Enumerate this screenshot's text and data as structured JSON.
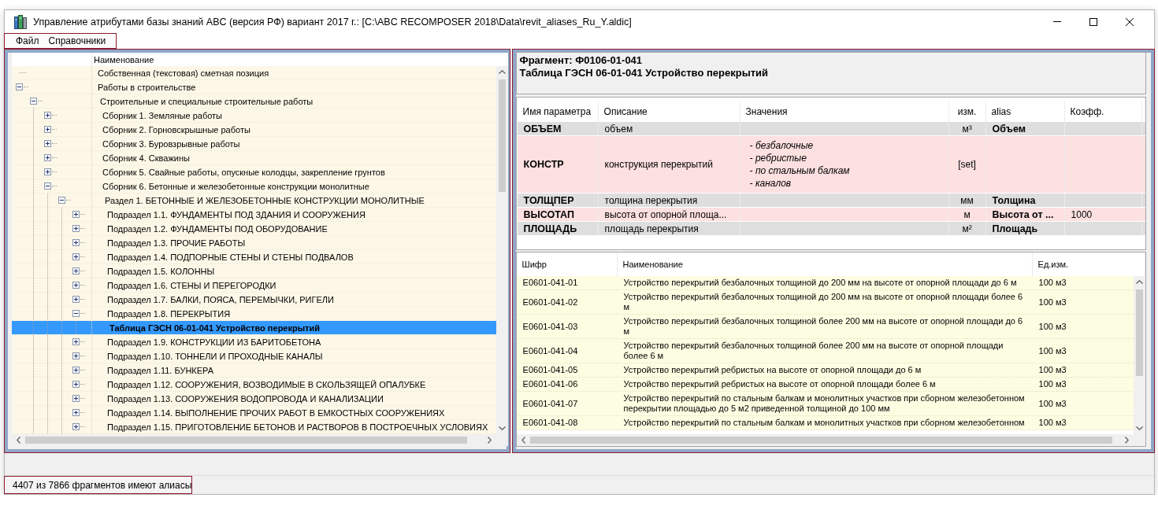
{
  "window": {
    "title": "Управление атрибутами базы знаний ABC (версия РФ) вариант 2017 г.: [C:\\ABC RECOMPOSER 2018\\Data\\revit_aliases_Ru_Y.aldic]"
  },
  "menu": [
    "Файл",
    "Справочники"
  ],
  "tree": {
    "column": "Наименование",
    "items": [
      {
        "label": "Собственная (текстовая) сметная позиция",
        "selected": false
      },
      {
        "label": "Работы в строительстве",
        "expanded": true,
        "selected": false,
        "children": [
          {
            "label": "Строительные и специальные строительные работы",
            "expanded": true,
            "selected": false,
            "children": [
              {
                "label": "Сборник 1. Земляные работы",
                "expanded": false,
                "selected": false
              },
              {
                "label": "Сборник 2. Горновскрышные работы",
                "expanded": false,
                "selected": false
              },
              {
                "label": "Сборник 3. Буровзрывные работы",
                "expanded": false,
                "selected": false
              },
              {
                "label": "Сборник 4. Скважины",
                "expanded": false,
                "selected": false
              },
              {
                "label": "Сборник 5. Свайные работы, опускные колодцы, закрепление грунтов",
                "expanded": false,
                "selected": false
              },
              {
                "label": "Сборник 6. Бетонные и железобетонные конструкции монолитные",
                "expanded": true,
                "selected": false,
                "children": [
                  {
                    "label": "Раздел 1. БЕТОННЫЕ И ЖЕЛЕЗОБЕТОННЫЕ КОНСТРУКЦИИ МОНОЛИТНЫЕ",
                    "expanded": true,
                    "selected": false,
                    "children": [
                      {
                        "label": "Подраздел 1.1. ФУНДАМЕНТЫ ПОД ЗДАНИЯ И СООРУЖЕНИЯ",
                        "expanded": false,
                        "selected": false
                      },
                      {
                        "label": "Подраздел 1.2. ФУНДАМЕНТЫ ПОД ОБОРУДОВАНИЕ",
                        "expanded": false,
                        "selected": false
                      },
                      {
                        "label": "Подраздел 1.3. ПРОЧИЕ РАБОТЫ",
                        "expanded": false,
                        "selected": false
                      },
                      {
                        "label": "Подраздел 1.4. ПОДПОРНЫЕ СТЕНЫ И СТЕНЫ ПОДВАЛОВ",
                        "expanded": false,
                        "selected": false
                      },
                      {
                        "label": "Подраздел 1.5. КОЛОННЫ",
                        "expanded": false,
                        "selected": false
                      },
                      {
                        "label": "Подраздел 1.6. СТЕНЫ И ПЕРЕГОРОДКИ",
                        "expanded": false,
                        "selected": false
                      },
                      {
                        "label": "Подраздел 1.7. БАЛКИ, ПОЯСА, ПЕРЕМЫЧКИ, РИГЕЛИ",
                        "expanded": false,
                        "selected": false
                      },
                      {
                        "label": "Подраздел 1.8. ПЕРЕКРЫТИЯ",
                        "expanded": true,
                        "selected": false,
                        "children": [
                          {
                            "label": "Таблица ГЭСН 06-01-041 Устройство перекрытий",
                            "selected": true
                          }
                        ]
                      },
                      {
                        "label": "Подраздел 1.9. КОНСТРУКЦИИ ИЗ БАРИТОБЕТОНА",
                        "expanded": false,
                        "selected": false
                      },
                      {
                        "label": "Подраздел 1.10. ТОННЕЛИ И ПРОХОДНЫЕ КАНАЛЫ",
                        "expanded": false,
                        "selected": false
                      },
                      {
                        "label": "Подраздел 1.11. БУНКЕРА",
                        "expanded": false,
                        "selected": false
                      },
                      {
                        "label": "Подраздел 1.12. СООРУЖЕНИЯ, ВОЗВОДИМЫЕ В СКОЛЬЗЯЩЕЙ ОПАЛУБКЕ",
                        "expanded": false,
                        "selected": false
                      },
                      {
                        "label": "Подраздел 1.13. СООРУЖЕНИЯ ВОДОПРОВОДА И КАНАЛИЗАЦИИ",
                        "expanded": false,
                        "selected": false
                      },
                      {
                        "label": "Подраздел 1.14. ВЫПОЛНЕНИЕ ПРОЧИХ РАБОТ В ЕМКОСТНЫХ СООРУЖЕНИЯХ",
                        "expanded": false,
                        "selected": false
                      },
                      {
                        "label": "Подраздел 1.15. ПРИГОТОВЛЕНИЕ БЕТОНОВ И РАСТВОРОВ В ПОСТРОЕЧНЫХ УСЛОВИЯХ",
                        "expanded": false,
                        "selected": false
                      }
                    ]
                  }
                ]
              }
            ]
          }
        ]
      }
    ]
  },
  "fragment": {
    "code": "Фрагмент: Ф0106-01-041",
    "title": "Таблица ГЭСН 06-01-041 Устройство перекрытий"
  },
  "params": {
    "columns": [
      "Имя параметра",
      "Описание",
      "Значения",
      "изм.",
      "alias",
      "Коэфф."
    ],
    "rows": [
      {
        "name": "ОБЪЕМ",
        "description": "объем",
        "unit": "м³",
        "alias": "Объем",
        "highlighted": false
      },
      {
        "name": "КОНСТР",
        "description": "конструкция перекрытий",
        "values": [
          "- безбалочные",
          "- ребристые",
          "- по стальным балкам",
          "- каналов"
        ],
        "unit": "[set]",
        "highlighted": true
      },
      {
        "name": "ТОЛЩПЕР",
        "description": "толщина перекрытия",
        "unit": "мм",
        "alias": "Толщина",
        "highlighted": false
      },
      {
        "name": "ВЫСОТАП",
        "description": "высота от опорной площа...",
        "unit": "м",
        "alias": "Высота от ...",
        "coefficient": "1000",
        "highlighted": true
      },
      {
        "name": "ПЛОЩАДЬ",
        "description": "площадь перекрытия",
        "unit": "м²",
        "alias": "Площадь",
        "highlighted": false
      }
    ]
  },
  "rates": {
    "columns": [
      "Шифр",
      "Наименование",
      "Ед.изм."
    ],
    "rows": [
      {
        "code": "E0601-041-01",
        "name": "Устройство перекрытий безбалочных толщиной до 200 мм на высоте от опорной площади до 6 м",
        "unit": "100 м3"
      },
      {
        "code": "E0601-041-02",
        "name": "Устройство перекрытий безбалочных толщиной до 200 мм на высоте от опорной площади более 6 м",
        "unit": "100 м3"
      },
      {
        "code": "E0601-041-03",
        "name": "Устройство перекрытий безбалочных толщиной более 200 мм на высоте от опорной площади до 6 м",
        "unit": "100 м3"
      },
      {
        "code": "E0601-041-04",
        "name": "Устройство перекрытий безбалочных толщиной более 200 мм на высоте от опорной площади более 6 м",
        "unit": "100 м3"
      },
      {
        "code": "E0601-041-05",
        "name": "Устройство перекрытий ребристых на высоте от опорной площади до 6 м",
        "unit": "100 м3"
      },
      {
        "code": "E0601-041-06",
        "name": "Устройство перекрытий ребристых на высоте от опорной площади более 6 м",
        "unit": "100 м3"
      },
      {
        "code": "E0601-041-07",
        "name": "Устройство перекрытий по стальным балкам и монолитных участков при сборном железобетонном перекрытии площадью до 5 м2 приведенной толщиной до 100 мм",
        "unit": "100 м3"
      },
      {
        "code": "E0601-041-08",
        "name": "Устройство перекрытий по стальным балкам и монолитных участков при сборном железобетонном",
        "unit": "100 м3"
      }
    ]
  },
  "status_bar": {
    "text": "4407 из 7866 фрагментов имеют алиасы"
  }
}
